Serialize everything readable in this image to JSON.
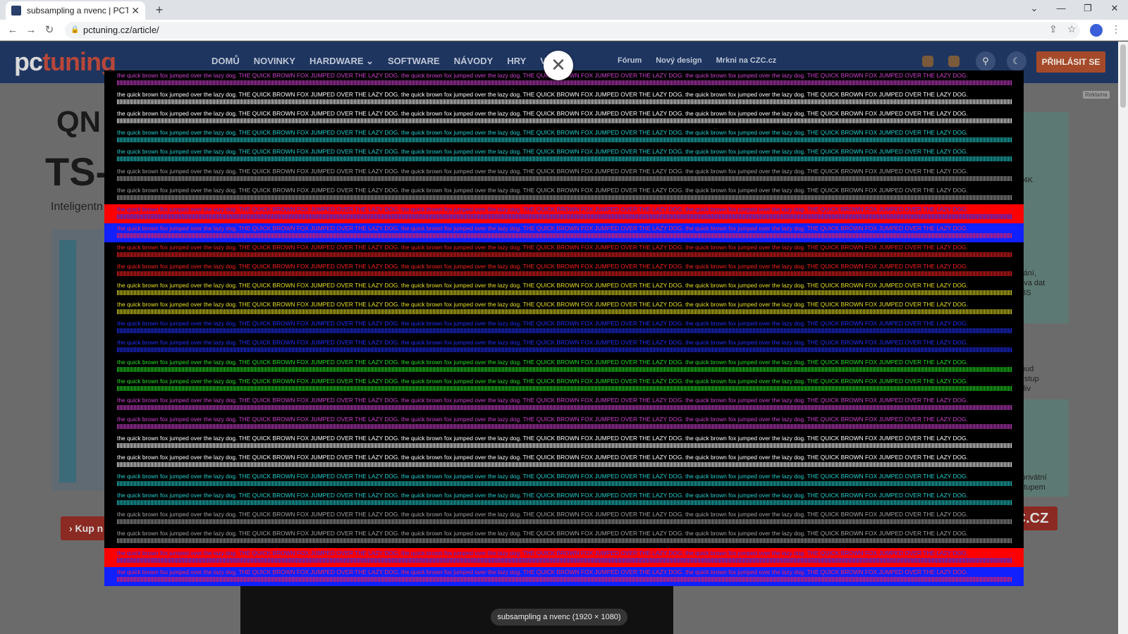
{
  "browser": {
    "tab_title": "subsampling a nvenc | PCTuning",
    "tab_close": "✕",
    "new_tab": "+",
    "url": "pctuning.cz/article/",
    "lock_icon": "🔒",
    "back": "←",
    "forward": "→",
    "reload": "↻",
    "win_chevron": "⌄",
    "win_min": "—",
    "win_max": "❐",
    "win_close": "✕",
    "share": "⇪",
    "star": "☆",
    "menu": "⋮"
  },
  "site": {
    "logo_a": "pc",
    "logo_b": "tuning",
    "nav": [
      "DOMŮ",
      "NOVINKY",
      "HARDWARE ⌄",
      "SOFTWARE",
      "NÁVODY",
      "HRY",
      "VA ⌄"
    ],
    "subnav": [
      "Fórum",
      "Nový design",
      "Mrkni na CZC.cz"
    ],
    "login": "PŘIHLÁSIT SE",
    "search_icon": "⚲",
    "theme_icon": "☾",
    "reklama": "Reklama"
  },
  "ad": {
    "brand": "QN",
    "model": "TS-",
    "subtitle": "Inteligentn",
    "kup": "› Kup n",
    "czc": "C.CZ",
    "right_texts": [
      "ei 4K",
      "se",
      "ování,",
      "nova dat",
      "HBS",
      "cloud",
      "přístup",
      "koliv",
      "ý privátní",
      "řístupem"
    ]
  },
  "lightbox": {
    "close_icon": "✕",
    "caption": "subsampling a nvenc (1920 × 1080)",
    "text_line": "the quick brown fox jumped over the lazy dog. THE QUICK BROWN FOX JUMPED OVER THE LAZY DOG. the quick brown fox jumped over the lazy dog. THE QUICK BROWN FOX JUMPED OVER THE LAZY DOG. the quick brown fox jumped over the lazy dog. THE QUICK BROWN FOX JUMPED OVER THE LAZY DOG.",
    "rows": [
      {
        "bg": "#000000",
        "fg": "#d040d0"
      },
      {
        "bg": "#000000",
        "fg": "#ffffff"
      },
      {
        "bg": "#000000",
        "fg": "#ffffff"
      },
      {
        "bg": "#000000",
        "fg": "#20d0d0"
      },
      {
        "bg": "#000000",
        "fg": "#20d0d0"
      },
      {
        "bg": "#000000",
        "fg": "#a0a0a0"
      },
      {
        "bg": "#000000",
        "fg": "#a0a0a0"
      },
      {
        "bg": "#ff0000",
        "fg": "#2030ff"
      },
      {
        "bg": "#1020ff",
        "fg": "#ff2040"
      },
      {
        "bg": "#000000",
        "fg": "#ff2020"
      },
      {
        "bg": "#000000",
        "fg": "#ff2020"
      },
      {
        "bg": "#000000",
        "fg": "#e8e020"
      },
      {
        "bg": "#000000",
        "fg": "#e8e020"
      },
      {
        "bg": "#000000",
        "fg": "#2030ff"
      },
      {
        "bg": "#000000",
        "fg": "#2030ff"
      },
      {
        "bg": "#000000",
        "fg": "#20e020"
      },
      {
        "bg": "#000000",
        "fg": "#20e020"
      },
      {
        "bg": "#000000",
        "fg": "#d040d0"
      },
      {
        "bg": "#000000",
        "fg": "#d040d0"
      },
      {
        "bg": "#000000",
        "fg": "#ffffff"
      },
      {
        "bg": "#000000",
        "fg": "#ffffff"
      },
      {
        "bg": "#000000",
        "fg": "#20d0d0"
      },
      {
        "bg": "#000000",
        "fg": "#20d0d0"
      },
      {
        "bg": "#000000",
        "fg": "#a0a0a0"
      },
      {
        "bg": "#000000",
        "fg": "#a0a0a0"
      },
      {
        "bg": "#ff0000",
        "fg": "#2030ff"
      },
      {
        "bg": "#1020ff",
        "fg": "#ff2040"
      }
    ]
  }
}
